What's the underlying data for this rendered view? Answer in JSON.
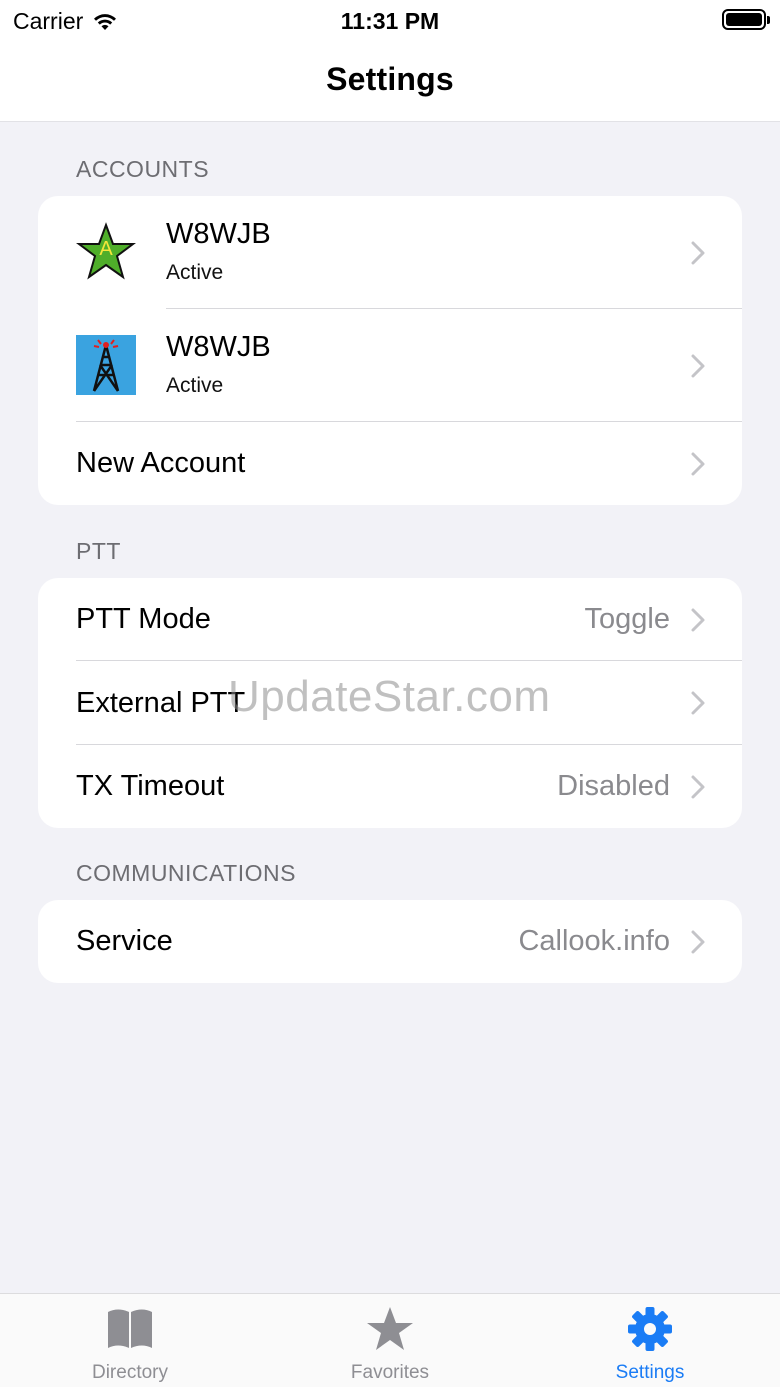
{
  "status_bar": {
    "carrier": "Carrier",
    "time": "11:31 PM"
  },
  "nav": {
    "title": "Settings"
  },
  "accounts": {
    "header": "ACCOUNTS",
    "items": [
      {
        "name": "W8WJB",
        "status": "Active",
        "icon": "star-a-icon"
      },
      {
        "name": "W8WJB",
        "status": "Active",
        "icon": "radio-tower-icon"
      }
    ],
    "new_account": "New Account"
  },
  "ptt": {
    "header": "PTT",
    "rows": [
      {
        "label": "PTT Mode",
        "value": "Toggle"
      },
      {
        "label": "External PTT",
        "value": ""
      },
      {
        "label": "TX Timeout",
        "value": "Disabled"
      }
    ]
  },
  "communications": {
    "header": "COMMUNICATIONS",
    "rows": [
      {
        "label": "Service",
        "value": "Callook.info"
      }
    ]
  },
  "watermark": "UpdateStar.com",
  "tabbar": {
    "tabs": [
      {
        "label": "Directory",
        "icon": "book-icon",
        "active": false
      },
      {
        "label": "Favorites",
        "icon": "star-icon",
        "active": false
      },
      {
        "label": "Settings",
        "icon": "gear-icon",
        "active": true
      }
    ]
  },
  "colors": {
    "accent": "#1a7cf5",
    "background": "#f2f2f7",
    "secondary_text": "#8a8a8e",
    "section_header": "#6d6d72"
  }
}
